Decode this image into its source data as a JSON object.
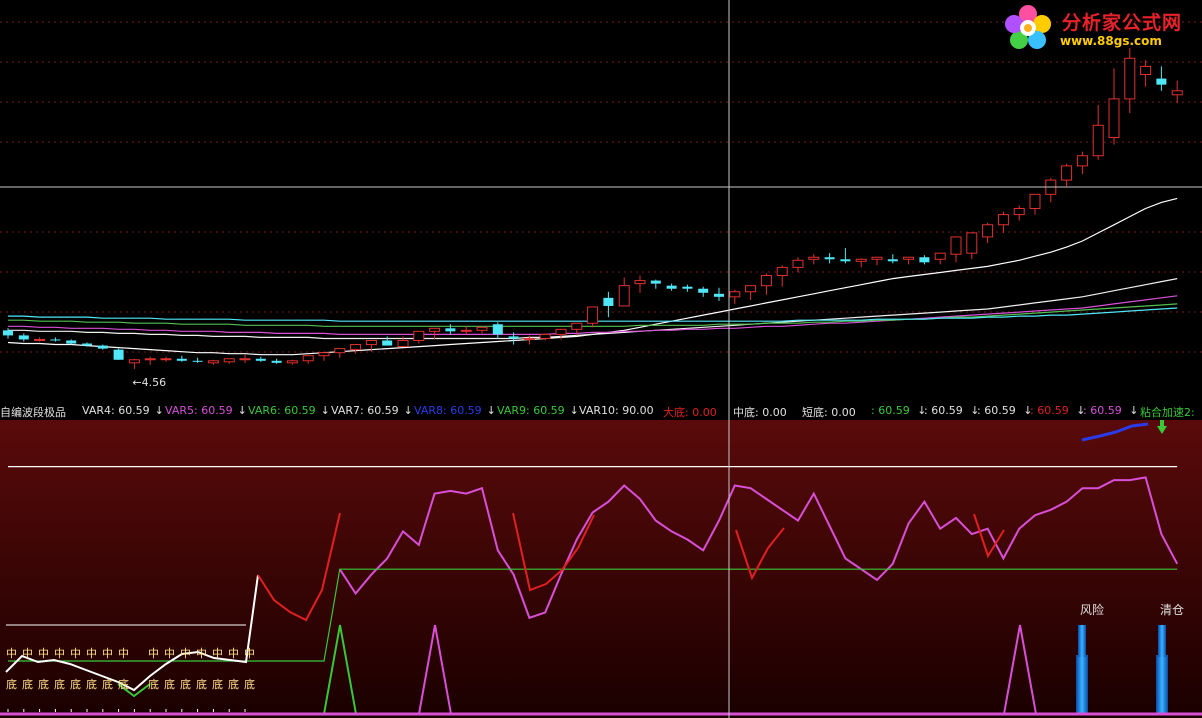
{
  "colors": {
    "bg": "#000000",
    "up": "#e03030",
    "down": "#50e8f8",
    "grid": "#8a1c1c",
    "crosshair": "#c8c8c8",
    "lowerBg": "#4a0606",
    "magenta": "#d84fd8",
    "red": "#e02020",
    "green": "#38c838",
    "blue": "#2a3ce8",
    "white": "#ffffff",
    "yellowLabel": "#ffe08a"
  },
  "watermark": {
    "title": "分析家公式网",
    "url": "www.88gs.com"
  },
  "header": {
    "items": [
      {
        "text": "自编波段极品",
        "color": "#e0e0e0"
      },
      {
        "text": "VAR4: 60.59",
        "color": "#e0e0e0",
        "arrow": "↓"
      },
      {
        "text": "VAR5: 60.59",
        "color": "#d84fd8",
        "arrow": "↓"
      },
      {
        "text": "VAR6: 60.59",
        "color": "#38c838",
        "arrow": "↓"
      },
      {
        "text": "VAR7: 60.59",
        "color": "#e0e0e0",
        "arrow": "↓"
      },
      {
        "text": "VAR8: 60.59",
        "color": "#2a3ce8",
        "arrow": "↓"
      },
      {
        "text": "VAR9: 60.59",
        "color": "#38c838",
        "arrow": "↓"
      },
      {
        "text": "VAR10: 90.00",
        "color": "#e0e0e0"
      },
      {
        "text": "大底: 0.00",
        "color": "#e02020"
      },
      {
        "text": "中底: 0.00",
        "color": "#e0e0e0"
      },
      {
        "text": "短底: 0.00",
        "color": "#e0e0e0"
      },
      {
        "text": ": 60.59",
        "color": "#38c838",
        "arrow": "↓"
      },
      {
        "text": ": 60.59",
        "color": "#e0e0e0",
        "arrow": "↓"
      },
      {
        "text": ": 60.59",
        "color": "#e0e0e0",
        "arrow": "↓"
      },
      {
        "text": ": 60.59",
        "color": "#e02020",
        "arrow": "↓"
      },
      {
        "text": ": 60.59",
        "color": "#d84fd8",
        "arrow": "↓"
      },
      {
        "text": "粘合加速2:",
        "color": "#38c838"
      }
    ]
  },
  "chart_data": [
    {
      "type": "candlestick",
      "annotation": {
        "text": "←4.56",
        "index": 8
      },
      "x": [
        1,
        2,
        3,
        4,
        5,
        6,
        7,
        8,
        9,
        10,
        11,
        12,
        13,
        14,
        15,
        16,
        17,
        18,
        19,
        20,
        21,
        22,
        23,
        24,
        25,
        26,
        27,
        28,
        29,
        30,
        31,
        32,
        33,
        34,
        35,
        36,
        37,
        38,
        39,
        40,
        41,
        42,
        43,
        44,
        45,
        46,
        47,
        48,
        49,
        50,
        51,
        52,
        53,
        54,
        55,
        56,
        57,
        58,
        59,
        60,
        61,
        62,
        63,
        64,
        65,
        66,
        67,
        68,
        69,
        70,
        71,
        72,
        73,
        74,
        75
      ],
      "open": [
        5.34,
        5.29,
        5.25,
        5.25,
        5.24,
        5.21,
        5.19,
        5.15,
        5.02,
        5.05,
        5.06,
        5.06,
        5.04,
        5.02,
        5.03,
        5.06,
        5.06,
        5.04,
        5.02,
        5.04,
        5.09,
        5.12,
        5.15,
        5.2,
        5.24,
        5.18,
        5.24,
        5.33,
        5.36,
        5.33,
        5.34,
        5.4,
        5.28,
        5.26,
        5.26,
        5.3,
        5.35,
        5.41,
        5.66,
        5.58,
        5.8,
        5.83,
        5.78,
        5.77,
        5.75,
        5.7,
        5.67,
        5.72,
        5.78,
        5.88,
        5.96,
        6.04,
        6.06,
        6.04,
        6.02,
        6.04,
        6.04,
        6.04,
        6.06,
        6.04,
        6.09,
        6.1,
        6.26,
        6.38,
        6.48,
        6.54,
        6.68,
        6.82,
        6.96,
        7.06,
        7.24,
        7.62,
        7.86,
        7.82,
        7.66
      ],
      "high": [
        5.36,
        5.31,
        5.27,
        5.27,
        5.25,
        5.22,
        5.2,
        5.16,
        5.06,
        5.08,
        5.08,
        5.09,
        5.07,
        5.05,
        5.06,
        5.1,
        5.08,
        5.06,
        5.05,
        5.06,
        5.13,
        5.15,
        5.17,
        5.24,
        5.28,
        5.28,
        5.28,
        5.36,
        5.4,
        5.38,
        5.37,
        5.42,
        5.32,
        5.29,
        5.31,
        5.35,
        5.41,
        5.53,
        5.72,
        5.86,
        5.88,
        5.84,
        5.8,
        5.79,
        5.77,
        5.76,
        5.74,
        5.77,
        5.9,
        5.98,
        6.06,
        6.09,
        6.1,
        6.15,
        6.05,
        6.06,
        6.09,
        6.06,
        6.08,
        6.1,
        6.16,
        6.27,
        6.4,
        6.51,
        6.57,
        6.64,
        6.84,
        6.98,
        7.1,
        7.56,
        7.92,
        8.12,
        8.0,
        7.94,
        7.8
      ],
      "low": [
        5.26,
        5.23,
        5.23,
        5.23,
        5.2,
        5.18,
        5.15,
        5.05,
        4.96,
        5.0,
        5.03,
        5.03,
        5.02,
        5.0,
        5.01,
        5.02,
        5.03,
        5.01,
        5.0,
        5.01,
        5.04,
        5.07,
        5.11,
        5.13,
        5.19,
        5.2,
        5.21,
        5.25,
        5.3,
        5.3,
        5.31,
        5.26,
        5.2,
        5.2,
        5.24,
        5.25,
        5.29,
        5.37,
        5.47,
        5.64,
        5.71,
        5.75,
        5.73,
        5.72,
        5.67,
        5.63,
        5.6,
        5.64,
        5.69,
        5.77,
        5.91,
        5.99,
        6.0,
        6.0,
        5.96,
        5.98,
        6.0,
        5.99,
        5.99,
        5.99,
        6.01,
        6.04,
        6.2,
        6.3,
        6.42,
        6.48,
        6.6,
        6.76,
        6.88,
        7.02,
        7.17,
        7.48,
        7.74,
        7.7,
        7.58
      ],
      "close": [
        5.29,
        5.25,
        5.25,
        5.24,
        5.21,
        5.19,
        5.16,
        5.05,
        5.05,
        5.06,
        5.06,
        5.04,
        5.03,
        5.04,
        5.06,
        5.06,
        5.04,
        5.02,
        5.04,
        5.09,
        5.12,
        5.16,
        5.2,
        5.24,
        5.19,
        5.24,
        5.33,
        5.36,
        5.33,
        5.34,
        5.37,
        5.3,
        5.26,
        5.26,
        5.3,
        5.35,
        5.41,
        5.57,
        5.58,
        5.78,
        5.83,
        5.8,
        5.75,
        5.75,
        5.71,
        5.67,
        5.72,
        5.78,
        5.88,
        5.96,
        6.03,
        6.06,
        6.04,
        6.02,
        6.04,
        6.06,
        6.02,
        6.06,
        6.01,
        6.1,
        6.26,
        6.3,
        6.38,
        6.48,
        6.54,
        6.68,
        6.82,
        6.96,
        7.06,
        7.36,
        7.62,
        8.02,
        7.94,
        7.76,
        7.7
      ],
      "ma": [
        {
          "color": "#ffffff",
          "values": [
            5.22,
            5.21,
            5.21,
            5.2,
            5.2,
            5.19,
            5.18,
            5.17,
            5.16,
            5.15,
            5.14,
            5.13,
            5.12,
            5.12,
            5.11,
            5.11,
            5.1,
            5.1,
            5.1,
            5.11,
            5.12,
            5.13,
            5.14,
            5.15,
            5.16,
            5.17,
            5.18,
            5.19,
            5.2,
            5.21,
            5.22,
            5.23,
            5.24,
            5.25,
            5.26,
            5.27,
            5.28,
            5.3,
            5.32,
            5.34,
            5.37,
            5.4,
            5.43,
            5.46,
            5.49,
            5.52,
            5.55,
            5.58,
            5.61,
            5.64,
            5.67,
            5.7,
            5.73,
            5.76,
            5.79,
            5.82,
            5.85,
            5.87,
            5.89,
            5.91,
            5.93,
            5.95,
            5.97,
            6.0,
            6.03,
            6.07,
            6.11,
            6.16,
            6.22,
            6.3,
            6.38,
            6.46,
            6.54,
            6.6,
            6.64
          ]
        },
        {
          "color": "#f0f0f0",
          "values": [
            5.34,
            5.34,
            5.33,
            5.33,
            5.33,
            5.32,
            5.32,
            5.31,
            5.31,
            5.3,
            5.3,
            5.29,
            5.29,
            5.28,
            5.28,
            5.28,
            5.27,
            5.27,
            5.27,
            5.27,
            5.26,
            5.26,
            5.26,
            5.26,
            5.26,
            5.26,
            5.26,
            5.26,
            5.26,
            5.26,
            5.26,
            5.26,
            5.26,
            5.27,
            5.27,
            5.28,
            5.29,
            5.3,
            5.31,
            5.32,
            5.33,
            5.34,
            5.35,
            5.36,
            5.37,
            5.38,
            5.39,
            5.4,
            5.41,
            5.42,
            5.43,
            5.44,
            5.45,
            5.46,
            5.47,
            5.48,
            5.49,
            5.5,
            5.51,
            5.52,
            5.53,
            5.54,
            5.55,
            5.57,
            5.59,
            5.61,
            5.63,
            5.65,
            5.67,
            5.7,
            5.73,
            5.76,
            5.79,
            5.82,
            5.85
          ]
        },
        {
          "color": "#d84fd8",
          "values": [
            5.38,
            5.38,
            5.37,
            5.37,
            5.36,
            5.36,
            5.36,
            5.35,
            5.35,
            5.34,
            5.34,
            5.33,
            5.33,
            5.33,
            5.32,
            5.32,
            5.32,
            5.31,
            5.31,
            5.31,
            5.31,
            5.3,
            5.3,
            5.3,
            5.3,
            5.3,
            5.3,
            5.3,
            5.3,
            5.3,
            5.3,
            5.3,
            5.3,
            5.3,
            5.3,
            5.31,
            5.31,
            5.32,
            5.32,
            5.33,
            5.33,
            5.34,
            5.34,
            5.35,
            5.35,
            5.36,
            5.36,
            5.37,
            5.38,
            5.38,
            5.39,
            5.4,
            5.41,
            5.41,
            5.42,
            5.43,
            5.44,
            5.45,
            5.46,
            5.47,
            5.48,
            5.49,
            5.5,
            5.51,
            5.52,
            5.53,
            5.54,
            5.55,
            5.56,
            5.58,
            5.6,
            5.62,
            5.64,
            5.66,
            5.68
          ]
        },
        {
          "color": "#50c050",
          "values": [
            5.44,
            5.44,
            5.43,
            5.43,
            5.43,
            5.42,
            5.42,
            5.42,
            5.41,
            5.41,
            5.41,
            5.4,
            5.4,
            5.4,
            5.4,
            5.39,
            5.39,
            5.39,
            5.39,
            5.39,
            5.38,
            5.38,
            5.38,
            5.38,
            5.38,
            5.38,
            5.38,
            5.38,
            5.38,
            5.38,
            5.38,
            5.38,
            5.38,
            5.38,
            5.38,
            5.38,
            5.38,
            5.38,
            5.38,
            5.38,
            5.39,
            5.39,
            5.39,
            5.39,
            5.39,
            5.4,
            5.4,
            5.4,
            5.41,
            5.41,
            5.41,
            5.42,
            5.42,
            5.43,
            5.43,
            5.44,
            5.44,
            5.45,
            5.45,
            5.46,
            5.47,
            5.47,
            5.48,
            5.49,
            5.5,
            5.51,
            5.52,
            5.53,
            5.54,
            5.55,
            5.56,
            5.57,
            5.58,
            5.59,
            5.6
          ]
        },
        {
          "color": "#50e8f8",
          "values": [
            5.48,
            5.48,
            5.47,
            5.47,
            5.47,
            5.47,
            5.46,
            5.46,
            5.46,
            5.46,
            5.45,
            5.45,
            5.45,
            5.45,
            5.45,
            5.44,
            5.44,
            5.44,
            5.44,
            5.44,
            5.44,
            5.43,
            5.43,
            5.43,
            5.43,
            5.43,
            5.43,
            5.43,
            5.43,
            5.43,
            5.43,
            5.43,
            5.43,
            5.43,
            5.43,
            5.43,
            5.43,
            5.43,
            5.43,
            5.43,
            5.43,
            5.43,
            5.43,
            5.43,
            5.43,
            5.43,
            5.43,
            5.43,
            5.43,
            5.43,
            5.44,
            5.44,
            5.44,
            5.44,
            5.44,
            5.45,
            5.45,
            5.45,
            5.45,
            5.46,
            5.46,
            5.46,
            5.47,
            5.47,
            5.48,
            5.48,
            5.49,
            5.49,
            5.5,
            5.51,
            5.52,
            5.53,
            5.54,
            5.55,
            5.56
          ]
        }
      ],
      "ylim": [
        4.9,
        8.2
      ]
    },
    {
      "type": "line",
      "ylim": [
        0,
        100
      ],
      "series": [
        {
          "color": "#d84fd8",
          "values": [
            null,
            null,
            null,
            null,
            null,
            null,
            null,
            null,
            null,
            null,
            null,
            null,
            null,
            null,
            null,
            null,
            null,
            null,
            null,
            null,
            null,
            54,
            45,
            52,
            58,
            68,
            63,
            82,
            83,
            82,
            84,
            61,
            52,
            36,
            38,
            52,
            65,
            75,
            79,
            85,
            80,
            72,
            68,
            65,
            61,
            72,
            85,
            84,
            80,
            76,
            72,
            82,
            70,
            58,
            54,
            50,
            56,
            71,
            79,
            69,
            73,
            67,
            69,
            58,
            69,
            74,
            76,
            79,
            84,
            84,
            87,
            87,
            88,
            67,
            56
          ]
        },
        {
          "color": "#e02020",
          "values": [
            null,
            null,
            null,
            null,
            null,
            null,
            null,
            null,
            null,
            null,
            null,
            null,
            null,
            null,
            null,
            null,
            null,
            null,
            null,
            null,
            null,
            null,
            null,
            null,
            null,
            null,
            null,
            null,
            null,
            null,
            null,
            null,
            null,
            null,
            null,
            null,
            null,
            null,
            null,
            null,
            null,
            null,
            null,
            null,
            null,
            null,
            null,
            null,
            null,
            null,
            null,
            null,
            null,
            null,
            null,
            null,
            null,
            null,
            null,
            null,
            null,
            null,
            null,
            null,
            null,
            null,
            null,
            null,
            null,
            null,
            null,
            null,
            null,
            null,
            null
          ]
        },
        {
          "color": "#38c838",
          "values": [
            20,
            20,
            20,
            20,
            20,
            20,
            20,
            20,
            20,
            20,
            20,
            20,
            20,
            20,
            20,
            20,
            20,
            20,
            20,
            20,
            20,
            54,
            54,
            54,
            54,
            54,
            54,
            54,
            54,
            54,
            54,
            54,
            54,
            54,
            54,
            54,
            54,
            54,
            54,
            54,
            54,
            54,
            54,
            54,
            54,
            54,
            54,
            54,
            54,
            54,
            54,
            54,
            54,
            54,
            54,
            54,
            54,
            54,
            54,
            54,
            54,
            54,
            54,
            54,
            54,
            54,
            54,
            54,
            54,
            54,
            54,
            54,
            54,
            54,
            54
          ]
        },
        {
          "color": "#ffffff",
          "values": [
            92,
            92,
            92,
            92,
            92,
            92,
            92,
            92,
            92,
            92,
            92,
            92,
            92,
            92,
            92,
            92,
            92,
            92,
            92,
            92,
            92,
            92,
            92,
            92,
            92,
            92,
            92,
            92,
            92,
            92,
            92,
            92,
            92,
            92,
            92,
            92,
            92,
            92,
            92,
            92,
            92,
            92,
            92,
            92,
            92,
            92,
            92,
            92,
            92,
            92,
            92,
            92,
            92,
            92,
            92,
            92,
            92,
            92,
            92,
            92,
            92,
            92,
            92,
            92,
            92,
            92,
            92,
            92,
            92,
            92,
            92,
            92,
            92,
            92,
            92
          ]
        }
      ]
    }
  ],
  "lower": {
    "risk_label": "风险",
    "clear_label": "清仓",
    "zhong_char": "中",
    "di_char": "底"
  }
}
